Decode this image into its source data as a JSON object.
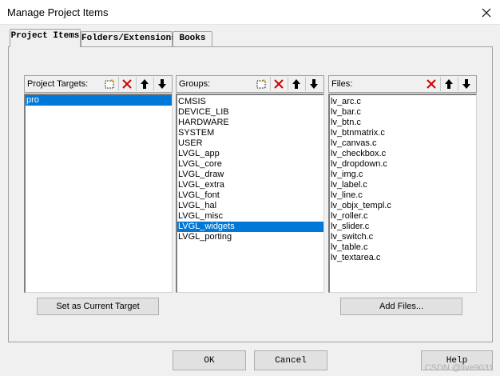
{
  "window": {
    "title": "Manage Project Items",
    "close_icon": "close-icon"
  },
  "tabs": [
    {
      "label": "Project Items",
      "active": true
    },
    {
      "label": "Folders/Extensions",
      "active": false
    },
    {
      "label": "Books",
      "active": false
    }
  ],
  "targets": {
    "label": "Project Targets:",
    "tools": [
      "new-icon",
      "delete-icon",
      "move-up-icon",
      "move-down-icon"
    ],
    "items": [
      "pro"
    ],
    "selected": "pro",
    "set_current_label": "Set as Current Target"
  },
  "groups": {
    "label": "Groups:",
    "tools": [
      "new-icon",
      "delete-icon",
      "move-up-icon",
      "move-down-icon"
    ],
    "items": [
      "CMSIS",
      "DEVICE_LIB",
      "HARDWARE",
      "SYSTEM",
      "USER",
      "LVGL_app",
      "LVGL_core",
      "LVGL_draw",
      "LVGL_extra",
      "LVGL_font",
      "LVGL_hal",
      "LVGL_misc",
      "LVGL_widgets",
      "LVGL_porting"
    ],
    "selected": "LVGL_widgets"
  },
  "files": {
    "label": "Files:",
    "tools": [
      "delete-icon",
      "move-up-icon",
      "move-down-icon"
    ],
    "items": [
      "lv_arc.c",
      "lv_bar.c",
      "lv_btn.c",
      "lv_btnmatrix.c",
      "lv_canvas.c",
      "lv_checkbox.c",
      "lv_dropdown.c",
      "lv_img.c",
      "lv_label.c",
      "lv_line.c",
      "lv_objx_templ.c",
      "lv_roller.c",
      "lv_slider.c",
      "lv_switch.c",
      "lv_table.c",
      "lv_textarea.c"
    ],
    "add_files_label": "Add Files..."
  },
  "footer": {
    "ok_label": "OK",
    "cancel_label": "Cancel",
    "help_label": "Help"
  },
  "watermark": "CSDN @live9031",
  "colors": {
    "selection": "#0078d7",
    "delete_red": "#cc0000"
  }
}
